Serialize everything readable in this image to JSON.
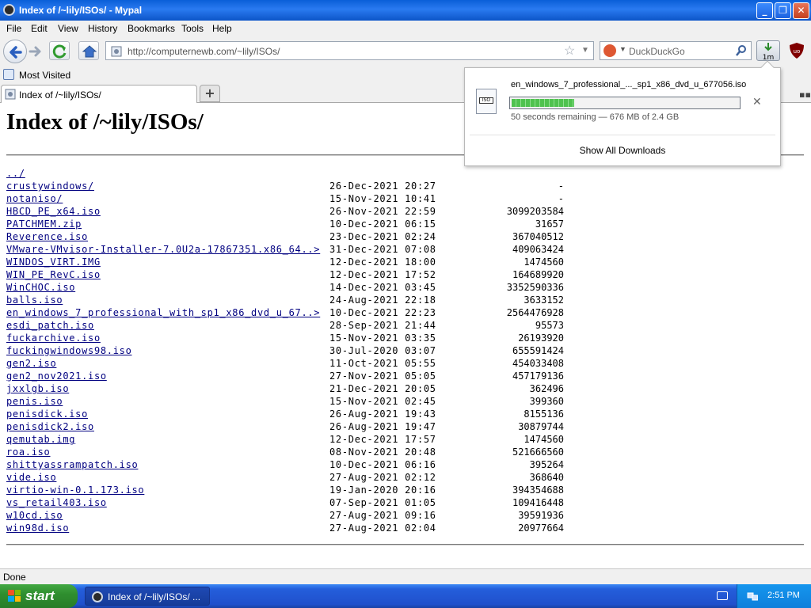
{
  "window": {
    "title": "Index of /~lily/ISOs/ - Mypal"
  },
  "menu": [
    "File",
    "Edit",
    "View",
    "History",
    "Bookmarks",
    "Tools",
    "Help"
  ],
  "navbar": {
    "url": "http://computernewb.com/~lily/ISOs/",
    "search_placeholder": "DuckDuckGo",
    "download_button_label": "1m"
  },
  "bookmarks": {
    "most_visited": "Most Visited"
  },
  "tabs": [
    {
      "label": "Index of /~lily/ISOs/"
    }
  ],
  "page": {
    "heading": "Index of /~lily/ISOs/"
  },
  "listing": [
    {
      "name": "../",
      "date": "",
      "size": ""
    },
    {
      "name": "crustywindows/",
      "date": "26-Dec-2021 20:27",
      "size": "-"
    },
    {
      "name": "notaniso/",
      "date": "15-Nov-2021 10:41",
      "size": "-"
    },
    {
      "name": "HBCD_PE_x64.iso",
      "date": "26-Nov-2021 22:59",
      "size": "3099203584"
    },
    {
      "name": "PATCHMEM.zip",
      "date": "10-Dec-2021 06:15",
      "size": "31657"
    },
    {
      "name": "Reverence.iso",
      "date": "23-Dec-2021 02:24",
      "size": "367040512"
    },
    {
      "name": "VMware-VMvisor-Installer-7.0U2a-17867351.x86_64..>",
      "date": "31-Dec-2021 07:08",
      "size": "409063424"
    },
    {
      "name": "WINDOS_VIRT.IMG",
      "date": "12-Dec-2021 18:00",
      "size": "1474560"
    },
    {
      "name": "WIN_PE_RevC.iso",
      "date": "12-Dec-2021 17:52",
      "size": "164689920"
    },
    {
      "name": "WinCHOC.iso",
      "date": "14-Dec-2021 03:45",
      "size": "3352590336"
    },
    {
      "name": "balls.iso",
      "date": "24-Aug-2021 22:18",
      "size": "3633152"
    },
    {
      "name": "en_windows_7_professional_with_sp1_x86_dvd_u_67..>",
      "date": "10-Dec-2021 22:23",
      "size": "2564476928"
    },
    {
      "name": "esdi_patch.iso",
      "date": "28-Sep-2021 21:44",
      "size": "95573"
    },
    {
      "name": "fuckarchive.iso",
      "date": "15-Nov-2021 03:35",
      "size": "26193920"
    },
    {
      "name": "fuckingwindows98.iso",
      "date": "30-Jul-2020 03:07",
      "size": "655591424"
    },
    {
      "name": "gen2.iso",
      "date": "11-Oct-2021 05:55",
      "size": "454033408"
    },
    {
      "name": "gen2_nov2021.iso",
      "date": "27-Nov-2021 05:05",
      "size": "457179136"
    },
    {
      "name": "jxxlgb.iso",
      "date": "21-Dec-2021 20:05",
      "size": "362496"
    },
    {
      "name": "penis.iso",
      "date": "15-Nov-2021 02:45",
      "size": "399360"
    },
    {
      "name": "penisdick.iso",
      "date": "26-Aug-2021 19:43",
      "size": "8155136"
    },
    {
      "name": "penisdick2.iso",
      "date": "26-Aug-2021 19:47",
      "size": "30879744"
    },
    {
      "name": "qemutab.img",
      "date": "12-Dec-2021 17:57",
      "size": "1474560"
    },
    {
      "name": "roa.iso",
      "date": "08-Nov-2021 20:48",
      "size": "521666560"
    },
    {
      "name": "shittyassrampatch.iso",
      "date": "10-Dec-2021 06:16",
      "size": "395264"
    },
    {
      "name": "vide.iso",
      "date": "27-Aug-2021 02:12",
      "size": "368640"
    },
    {
      "name": "virtio-win-0.1.173.iso",
      "date": "19-Jan-2020 20:16",
      "size": "394354688"
    },
    {
      "name": "vs_retail403.iso",
      "date": "07-Sep-2021 01:05",
      "size": "109416448"
    },
    {
      "name": "w10cd.iso",
      "date": "27-Aug-2021 09:16",
      "size": "39591936"
    },
    {
      "name": "win98d.iso",
      "date": "27-Aug-2021 02:04",
      "size": "20977664"
    }
  ],
  "download_panel": {
    "filename": "en_windows_7_professional_..._sp1_x86_dvd_u_677056.iso",
    "status": "50 seconds remaining — 676 MB of 2.4 GB",
    "progress_fraction": 0.275,
    "show_all": "Show All Downloads"
  },
  "statusbar": {
    "text": "Done"
  },
  "taskbar": {
    "start": "start",
    "task": "Index of /~lily/ISOs/ ...",
    "clock": "2:51 PM"
  }
}
